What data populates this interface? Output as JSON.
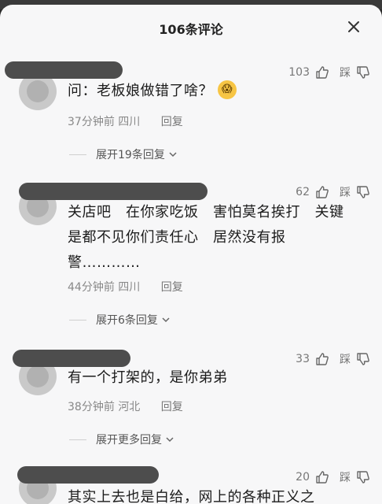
{
  "header": {
    "title": "106条评论"
  },
  "comments": [
    {
      "text": "问：老板娘做错了啥？",
      "emoji": "😱",
      "time": "37分钟前",
      "location": "四川",
      "reply_label": "回复",
      "likes": "103",
      "dislike_label": "踩",
      "expand_label": "展开19条回复"
    },
    {
      "text": "关店吧　在你家吃饭　害怕莫名挨打　关键是都不见你们责任心　居然没有报警…………",
      "time": "44分钟前",
      "location": "四川",
      "reply_label": "回复",
      "likes": "62",
      "dislike_label": "踩",
      "expand_label": "展开6条回复"
    },
    {
      "text": "有一个打架的，是你弟弟",
      "time": "38分钟前",
      "location": "河北",
      "reply_label": "回复",
      "likes": "33",
      "dislike_label": "踩",
      "expand_label": "展开更多回复"
    },
    {
      "text": "其实上去也是白给，网上的各种正义之",
      "likes": "20",
      "dislike_label": "踩"
    }
  ]
}
